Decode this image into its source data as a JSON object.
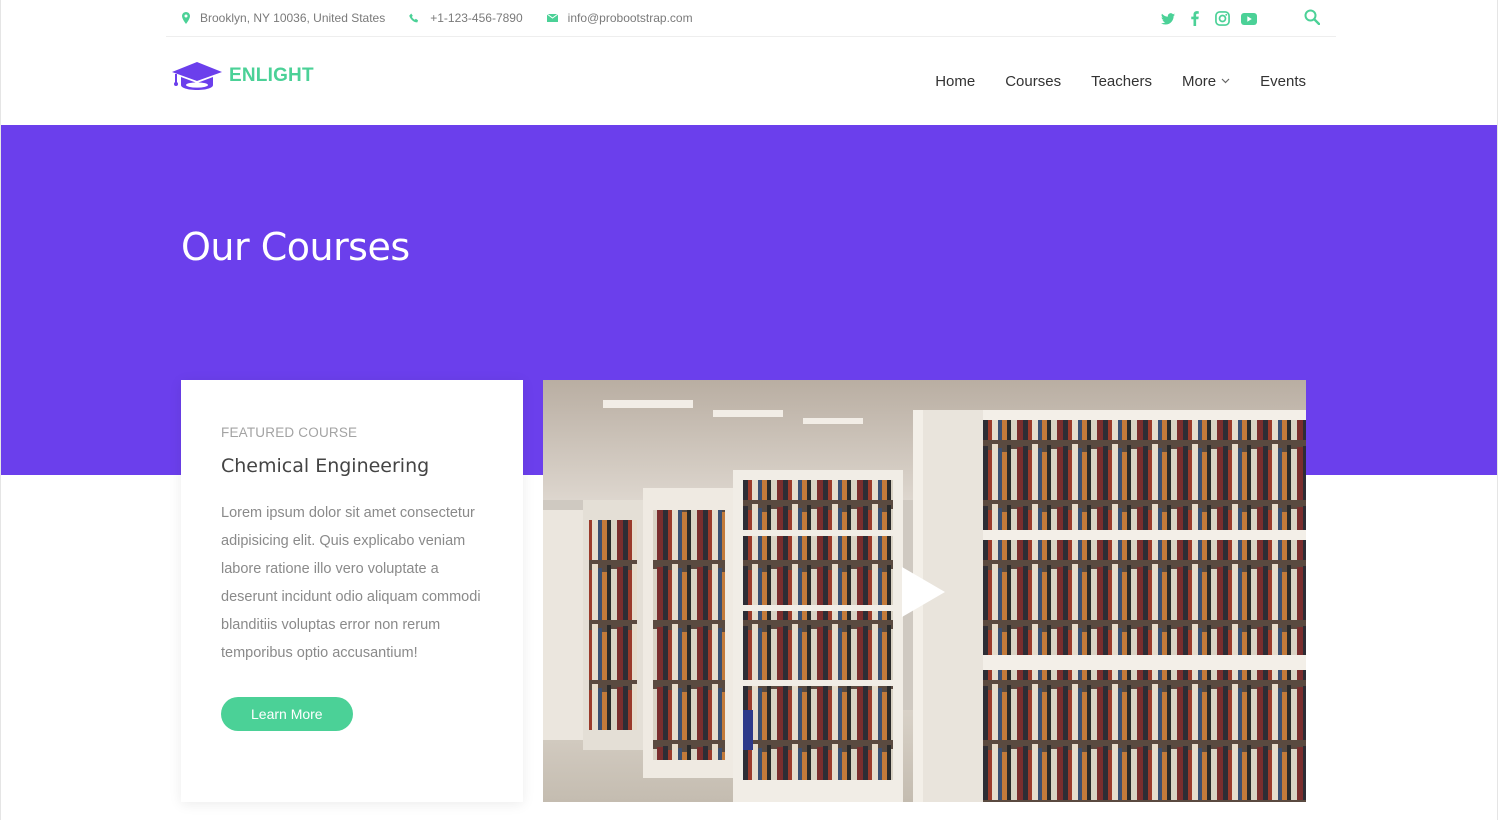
{
  "topbar": {
    "address": "Brooklyn, NY 10036, United States",
    "phone": "+1-123-456-7890",
    "email": "info@probootstrap.com",
    "icons": [
      "map-pin-icon",
      "phone-icon",
      "mail-icon",
      "twitter-icon",
      "facebook-icon",
      "instagram-icon",
      "youtube-icon",
      "search-icon"
    ]
  },
  "brand": {
    "name": "ENLIGHT",
    "icon": "graduation-cap-icon"
  },
  "nav": {
    "items": [
      {
        "label": "Home"
      },
      {
        "label": "Courses"
      },
      {
        "label": "Teachers"
      },
      {
        "label": "More"
      },
      {
        "label": "Events"
      }
    ]
  },
  "hero": {
    "title": "Our Courses"
  },
  "featured": {
    "kicker": "FEATURED COURSE",
    "title": "Chemical Engineering",
    "description": "Lorem ipsum dolor sit amet consectetur adipisicing elit. Quis explicabo veniam labore ratione illo vero voluptate a deserunt incidunt odio aliquam commodi blanditiis voluptas error non rerum temporibus optio accusantium!",
    "button_label": "Learn More"
  },
  "colors": {
    "accent": "#4bd197",
    "hero_bg": "#6b3fec",
    "brand_icon": "#6b3fec"
  }
}
